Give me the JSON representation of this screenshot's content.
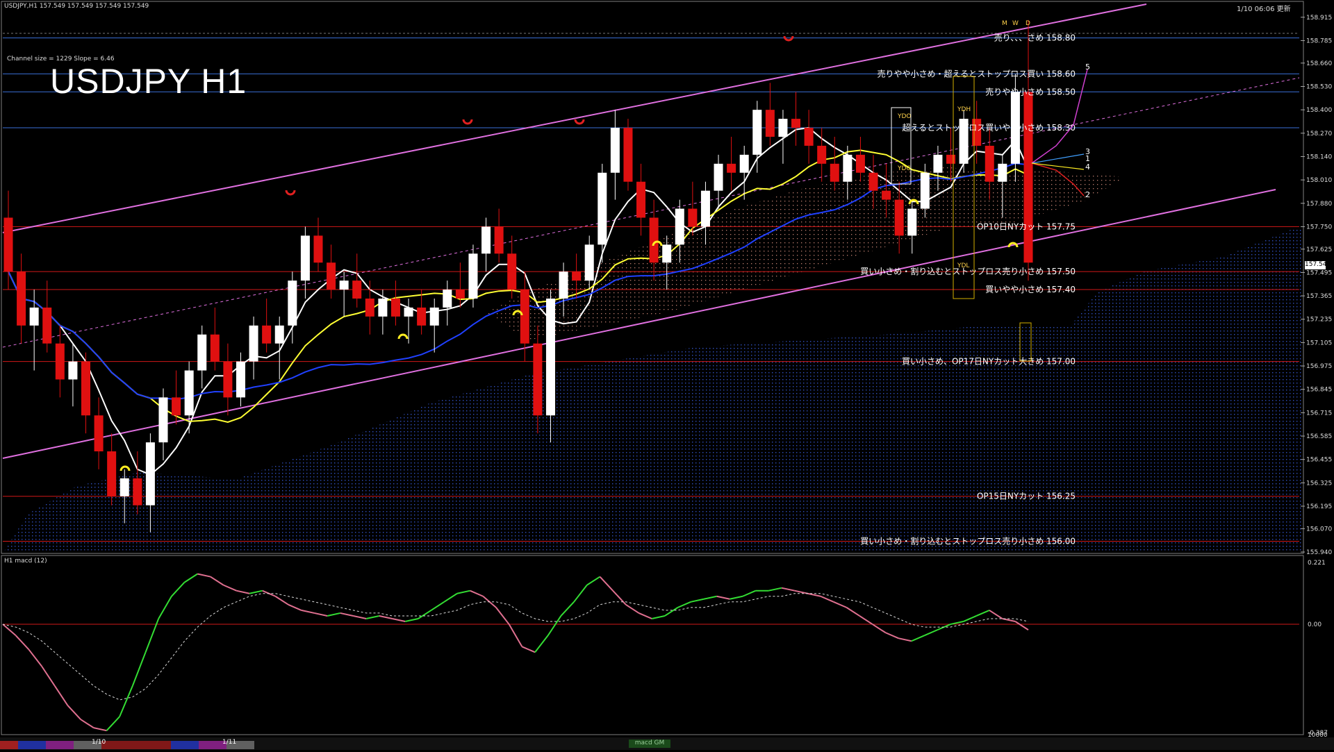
{
  "header": {
    "symbol_line": "USDJPY,H1  157.549 157.549 157.549 157.549",
    "updated": "1/10 06:06 更新",
    "channel_info": "Channel size = 1229 Slope = 6.46",
    "big_title": "USDJPY H1"
  },
  "macd_panel": {
    "label": "H1 macd (12)",
    "tab_label": "macd GM"
  },
  "price_axis": {
    "ticks": [
      "158.915",
      "158.785",
      "158.660",
      "158.530",
      "158.400",
      "158.270",
      "158.140",
      "158.010",
      "157.880",
      "157.750",
      "157.625",
      "157.495",
      "157.365",
      "157.235",
      "157.105",
      "156.975",
      "156.845",
      "156.715",
      "156.585",
      "156.455",
      "156.325",
      "156.195",
      "156.070",
      "155.940"
    ],
    "current_price": "157.549"
  },
  "macd_axis": {
    "ticks": [
      "0.221",
      "0.00",
      "-0.387",
      "10000"
    ]
  },
  "time_axis": {
    "labels": [
      "1/10",
      "1/11"
    ]
  },
  "chart_data": {
    "type": "candlestick",
    "symbol": "USDJPY",
    "timeframe": "H1",
    "ylim": [
      155.94,
      158.98
    ],
    "current_price": 157.549,
    "level_lines": [
      {
        "price": 158.8,
        "label": "売り、、、さめ 158.80",
        "color": "#3a6fd8"
      },
      {
        "price": 158.6,
        "label": "売りやや小さめ・超えるとストップロス買い 158.60",
        "color": "#3a6fd8"
      },
      {
        "price": 158.5,
        "label": "売りやや小さめ 158.50",
        "color": "#3a6fd8"
      },
      {
        "price": 158.3,
        "label": "超えるとストップロス買いやや小さめ 158.30",
        "color": "#3a6fd8"
      },
      {
        "price": 157.75,
        "label": "OP10日NYカット 157.75",
        "color": "#d21818"
      },
      {
        "price": 157.5,
        "label": "買い小さめ・割り込むとストップロス売り小さめ 157.50",
        "color": "#d21818"
      },
      {
        "price": 157.4,
        "label": "買いやや小さめ 157.40",
        "color": "#d21818"
      },
      {
        "price": 157.0,
        "label": "買い小さめ、OP17日NYカット大きめ 157.00",
        "color": "#d21818"
      },
      {
        "price": 156.25,
        "label": "OP15日NYカット 156.25",
        "color": "#d21818"
      },
      {
        "price": 156.0,
        "label": "買い小さめ・割り込むとストップロス売り小さめ 156.00",
        "color": "#d21818"
      }
    ],
    "box_labels": [
      "YDO",
      "YDC",
      "YDH",
      "YDL",
      "M",
      "W",
      "D"
    ],
    "projection_labels": [
      "5",
      "3",
      "1",
      "4",
      "2"
    ],
    "candles": [
      [
        157.8,
        157.95,
        157.4,
        157.5
      ],
      [
        157.5,
        157.6,
        157.1,
        157.2
      ],
      [
        157.2,
        157.4,
        156.95,
        157.3
      ],
      [
        157.3,
        157.45,
        157.05,
        157.1
      ],
      [
        157.1,
        157.2,
        156.8,
        156.9
      ],
      [
        156.9,
        157.1,
        156.75,
        157.0
      ],
      [
        157.0,
        157.05,
        156.6,
        156.7
      ],
      [
        156.7,
        156.8,
        156.4,
        156.5
      ],
      [
        156.5,
        156.6,
        156.2,
        156.25
      ],
      [
        156.25,
        156.4,
        156.1,
        156.35
      ],
      [
        156.35,
        156.5,
        156.15,
        156.2
      ],
      [
        156.2,
        156.6,
        156.05,
        156.55
      ],
      [
        156.55,
        156.85,
        156.45,
        156.8
      ],
      [
        156.8,
        156.95,
        156.65,
        156.7
      ],
      [
        156.7,
        157.0,
        156.6,
        156.95
      ],
      [
        156.95,
        157.2,
        156.85,
        157.15
      ],
      [
        157.15,
        157.3,
        156.95,
        157.0
      ],
      [
        157.0,
        157.1,
        156.7,
        156.8
      ],
      [
        156.8,
        157.05,
        156.75,
        157.0
      ],
      [
        157.0,
        157.25,
        156.9,
        157.2
      ],
      [
        157.2,
        157.35,
        157.05,
        157.1
      ],
      [
        157.1,
        157.25,
        156.9,
        157.2
      ],
      [
        157.2,
        157.5,
        157.1,
        157.45
      ],
      [
        157.45,
        157.75,
        157.35,
        157.7
      ],
      [
        157.7,
        157.8,
        157.5,
        157.55
      ],
      [
        157.55,
        157.65,
        157.35,
        157.4
      ],
      [
        157.4,
        157.5,
        157.25,
        157.45
      ],
      [
        157.45,
        157.6,
        157.3,
        157.35
      ],
      [
        157.35,
        157.45,
        157.15,
        157.25
      ],
      [
        157.25,
        157.4,
        157.15,
        157.35
      ],
      [
        157.35,
        157.45,
        157.2,
        157.25
      ],
      [
        157.25,
        157.35,
        157.1,
        157.3
      ],
      [
        157.3,
        157.4,
        157.15,
        157.2
      ],
      [
        157.2,
        157.35,
        157.05,
        157.3
      ],
      [
        157.3,
        157.45,
        157.2,
        157.4
      ],
      [
        157.4,
        157.55,
        157.3,
        157.35
      ],
      [
        157.35,
        157.65,
        157.3,
        157.6
      ],
      [
        157.6,
        157.8,
        157.5,
        157.75
      ],
      [
        157.75,
        157.85,
        157.55,
        157.6
      ],
      [
        157.6,
        157.7,
        157.35,
        157.4
      ],
      [
        157.4,
        157.5,
        157.0,
        157.1
      ],
      [
        157.1,
        157.2,
        156.6,
        156.7
      ],
      [
        156.7,
        157.4,
        156.55,
        157.35
      ],
      [
        157.35,
        157.55,
        157.25,
        157.5
      ],
      [
        157.5,
        157.6,
        157.35,
        157.45
      ],
      [
        157.45,
        157.7,
        157.4,
        157.65
      ],
      [
        157.65,
        158.1,
        157.55,
        158.05
      ],
      [
        158.05,
        158.4,
        157.9,
        158.3
      ],
      [
        158.3,
        158.35,
        157.95,
        158.0
      ],
      [
        158.0,
        158.1,
        157.7,
        157.8
      ],
      [
        157.8,
        157.9,
        157.45,
        157.55
      ],
      [
        157.55,
        157.7,
        157.4,
        157.65
      ],
      [
        157.65,
        157.9,
        157.55,
        157.85
      ],
      [
        157.85,
        158.0,
        157.7,
        157.75
      ],
      [
        157.75,
        158.0,
        157.65,
        157.95
      ],
      [
        157.95,
        158.15,
        157.85,
        158.1
      ],
      [
        158.1,
        158.25,
        157.95,
        158.05
      ],
      [
        158.05,
        158.2,
        157.9,
        158.15
      ],
      [
        158.15,
        158.45,
        158.05,
        158.4
      ],
      [
        158.4,
        158.55,
        158.2,
        158.25
      ],
      [
        158.25,
        158.4,
        158.1,
        158.35
      ],
      [
        158.35,
        158.5,
        158.2,
        158.3
      ],
      [
        158.3,
        158.4,
        158.1,
        158.2
      ],
      [
        158.2,
        158.3,
        158.0,
        158.1
      ],
      [
        158.1,
        158.25,
        157.95,
        158.0
      ],
      [
        158.0,
        158.2,
        157.9,
        158.15
      ],
      [
        158.15,
        158.25,
        158.0,
        158.05
      ],
      [
        158.05,
        158.15,
        157.85,
        157.95
      ],
      [
        157.95,
        158.1,
        157.8,
        157.9
      ],
      [
        157.9,
        158.0,
        157.6,
        157.7
      ],
      [
        157.7,
        157.9,
        157.6,
        157.85
      ],
      [
        157.85,
        158.1,
        157.8,
        158.05
      ],
      [
        158.05,
        158.2,
        157.95,
        158.15
      ],
      [
        158.15,
        158.3,
        158.0,
        158.1
      ],
      [
        158.1,
        158.4,
        158.05,
        158.35
      ],
      [
        158.35,
        158.45,
        158.1,
        158.2
      ],
      [
        158.2,
        158.3,
        157.9,
        158.0
      ],
      [
        158.0,
        158.15,
        157.8,
        158.1
      ],
      [
        158.1,
        158.6,
        158.0,
        158.5
      ],
      [
        158.5,
        158.9,
        157.45,
        157.55
      ]
    ],
    "macd": {
      "ylim": [
        -0.387,
        0.221
      ],
      "values": [
        0.0,
        -0.04,
        -0.09,
        -0.15,
        -0.22,
        -0.29,
        -0.34,
        -0.37,
        -0.38,
        -0.33,
        -0.22,
        -0.1,
        0.02,
        0.1,
        0.15,
        0.18,
        0.17,
        0.14,
        0.12,
        0.11,
        0.12,
        0.1,
        0.07,
        0.05,
        0.04,
        0.03,
        0.04,
        0.03,
        0.02,
        0.03,
        0.02,
        0.01,
        0.02,
        0.05,
        0.08,
        0.11,
        0.12,
        0.1,
        0.06,
        0.0,
        -0.08,
        -0.1,
        -0.04,
        0.03,
        0.08,
        0.14,
        0.17,
        0.12,
        0.07,
        0.04,
        0.02,
        0.03,
        0.06,
        0.08,
        0.09,
        0.1,
        0.09,
        0.1,
        0.12,
        0.12,
        0.13,
        0.12,
        0.11,
        0.1,
        0.08,
        0.06,
        0.03,
        0.0,
        -0.03,
        -0.05,
        -0.06,
        -0.04,
        -0.02,
        0.0,
        0.01,
        0.03,
        0.05,
        0.02,
        0.01,
        -0.02
      ],
      "signal": [
        0.0,
        -0.01,
        -0.03,
        -0.06,
        -0.1,
        -0.14,
        -0.18,
        -0.22,
        -0.25,
        -0.27,
        -0.26,
        -0.23,
        -0.18,
        -0.12,
        -0.06,
        -0.01,
        0.03,
        0.06,
        0.08,
        0.1,
        0.11,
        0.11,
        0.1,
        0.09,
        0.08,
        0.07,
        0.06,
        0.05,
        0.04,
        0.04,
        0.03,
        0.03,
        0.03,
        0.03,
        0.04,
        0.05,
        0.07,
        0.08,
        0.08,
        0.07,
        0.04,
        0.02,
        0.01,
        0.01,
        0.02,
        0.04,
        0.07,
        0.08,
        0.08,
        0.07,
        0.06,
        0.05,
        0.05,
        0.06,
        0.06,
        0.07,
        0.08,
        0.08,
        0.09,
        0.1,
        0.1,
        0.11,
        0.11,
        0.11,
        0.1,
        0.09,
        0.08,
        0.06,
        0.04,
        0.02,
        0.0,
        -0.01,
        -0.01,
        -0.01,
        0.0,
        0.01,
        0.02,
        0.02,
        0.02,
        0.01
      ]
    },
    "series_colors": {
      "bull": "#ffffff",
      "bear": "#e01010",
      "ma_fast": "#ffffff",
      "ma_mid": "#ffff33",
      "ma_slow": "#2040ff",
      "channel": "#e070e0",
      "macd": "#33dd33",
      "macd_neg": "#e07090",
      "signal": "#dddddd"
    }
  }
}
